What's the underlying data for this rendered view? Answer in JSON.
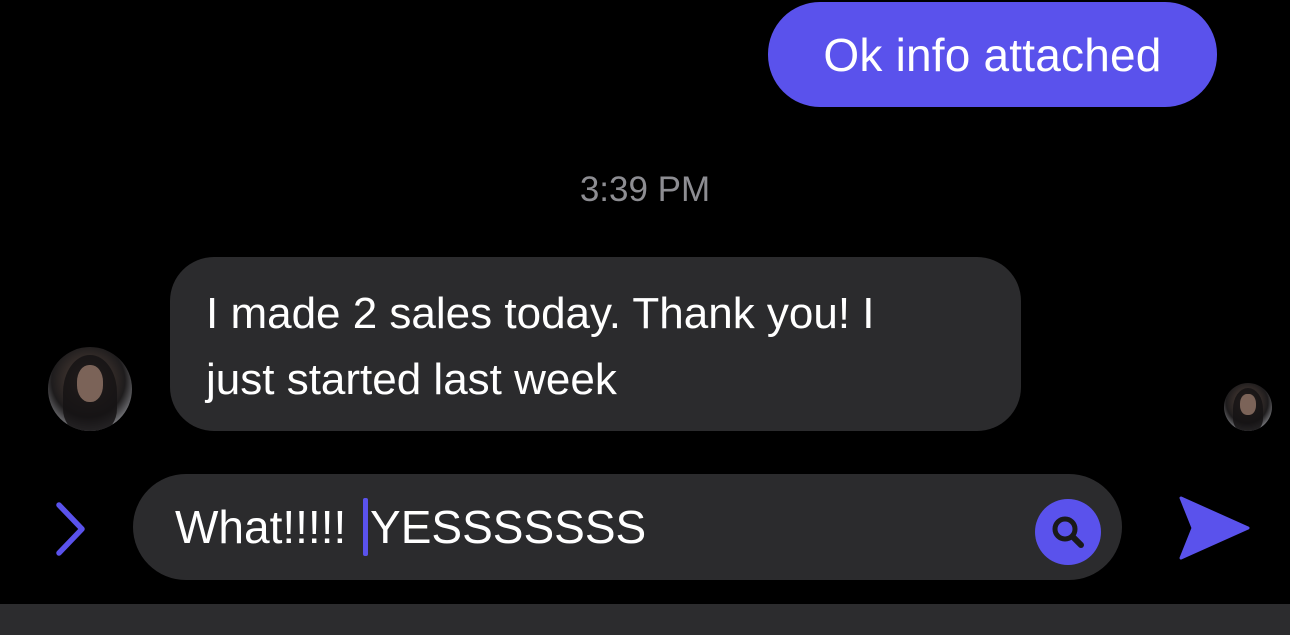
{
  "conversation": {
    "outgoing_message": "Ok info attached",
    "timestamp": "3:39 PM",
    "incoming_message_line1": "I made 2 sales today. Thank you! I",
    "incoming_message_line2": "just started last week"
  },
  "composer": {
    "text_before_caret": "What!!!!! ",
    "text_after_caret": "YESSSSSSS"
  },
  "icons": {
    "expand": "chevron-right-icon",
    "search": "magnifier-icon",
    "send": "send-arrow-icon"
  },
  "colors": {
    "accent": "#5a52ec",
    "bubble_incoming": "#2b2b2d",
    "background": "#000000",
    "timestamp": "#8d8d92"
  }
}
